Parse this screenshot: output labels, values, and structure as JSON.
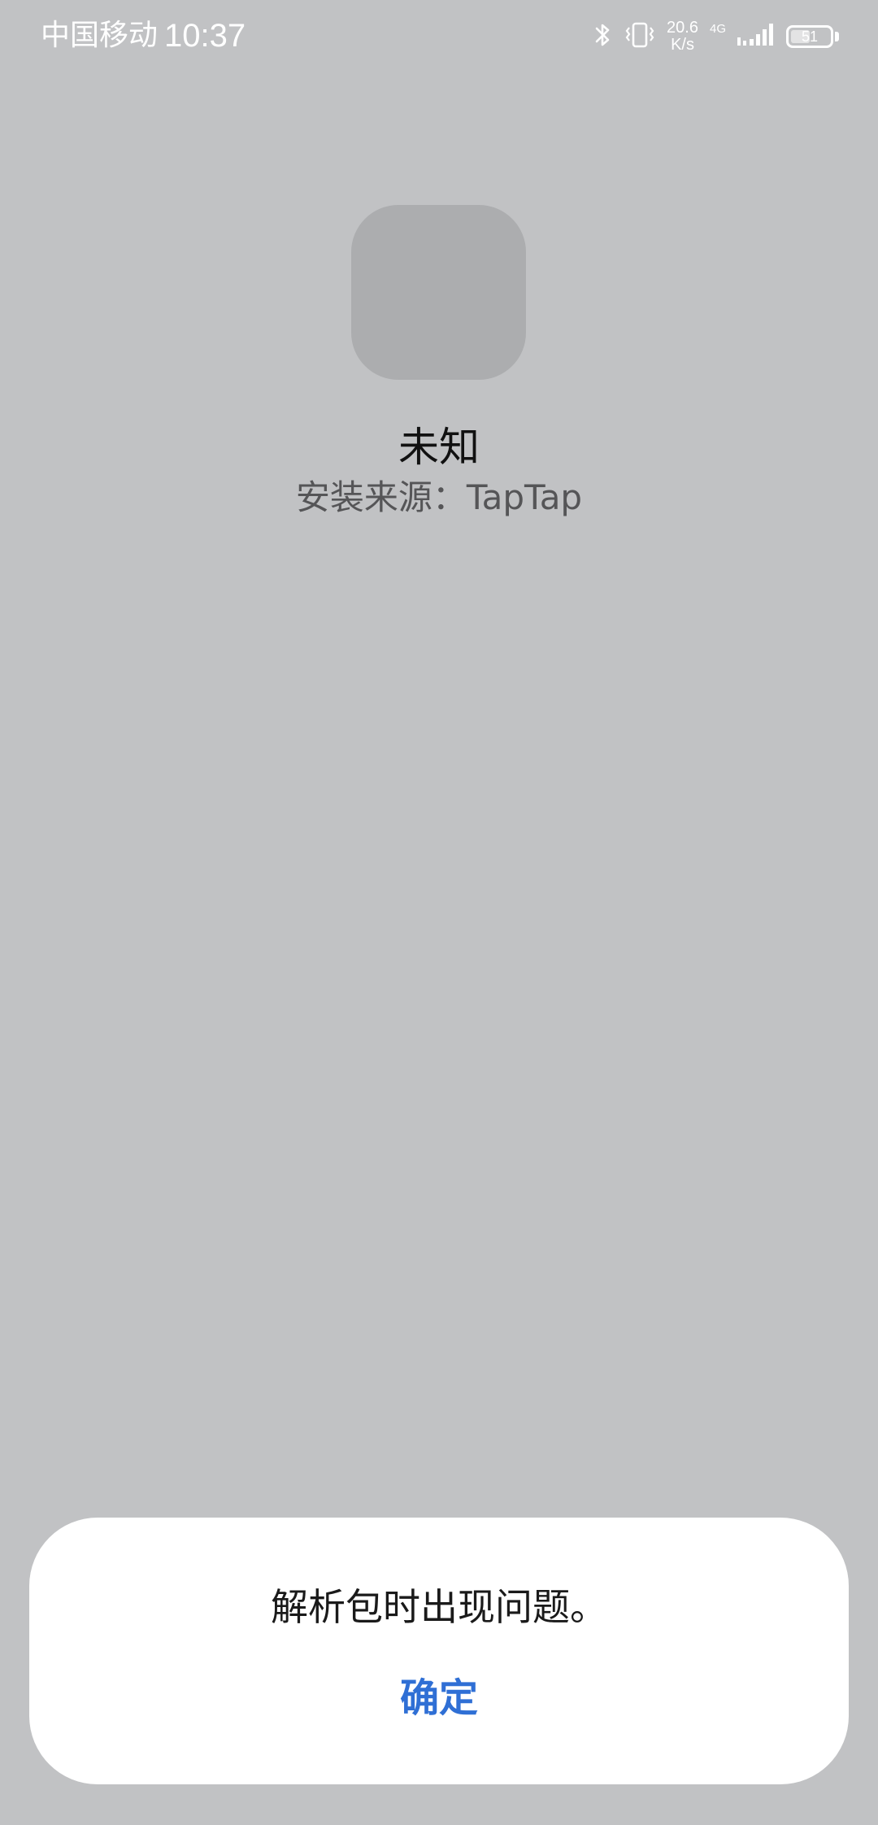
{
  "status_bar": {
    "carrier": "中国移动",
    "time": "10:37",
    "speed_value": "20.6",
    "speed_unit": "K/s",
    "network": "4G",
    "battery_level": "51",
    "battery_percent": 51
  },
  "app": {
    "name": "未知",
    "install_source": "安装来源：TapTap"
  },
  "dialog": {
    "message": "解析包时出现问题。",
    "confirm_label": "确定"
  },
  "colors": {
    "background": "#c1c2c4",
    "icon_placeholder": "#acadaf",
    "accent": "#2f6fd5",
    "dialog_bg": "#ffffff"
  }
}
